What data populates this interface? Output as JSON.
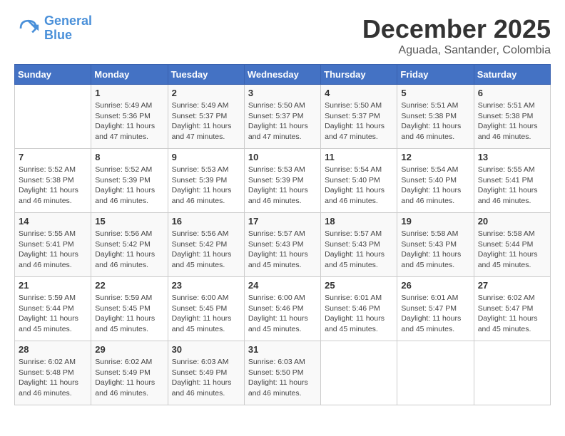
{
  "header": {
    "logo_line1": "General",
    "logo_line2": "Blue",
    "month": "December 2025",
    "location": "Aguada, Santander, Colombia"
  },
  "weekdays": [
    "Sunday",
    "Monday",
    "Tuesday",
    "Wednesday",
    "Thursday",
    "Friday",
    "Saturday"
  ],
  "weeks": [
    [
      {
        "day": "",
        "info": ""
      },
      {
        "day": "1",
        "info": "Sunrise: 5:49 AM\nSunset: 5:36 PM\nDaylight: 11 hours\nand 47 minutes."
      },
      {
        "day": "2",
        "info": "Sunrise: 5:49 AM\nSunset: 5:37 PM\nDaylight: 11 hours\nand 47 minutes."
      },
      {
        "day": "3",
        "info": "Sunrise: 5:50 AM\nSunset: 5:37 PM\nDaylight: 11 hours\nand 47 minutes."
      },
      {
        "day": "4",
        "info": "Sunrise: 5:50 AM\nSunset: 5:37 PM\nDaylight: 11 hours\nand 47 minutes."
      },
      {
        "day": "5",
        "info": "Sunrise: 5:51 AM\nSunset: 5:38 PM\nDaylight: 11 hours\nand 46 minutes."
      },
      {
        "day": "6",
        "info": "Sunrise: 5:51 AM\nSunset: 5:38 PM\nDaylight: 11 hours\nand 46 minutes."
      }
    ],
    [
      {
        "day": "7",
        "info": "Sunrise: 5:52 AM\nSunset: 5:38 PM\nDaylight: 11 hours\nand 46 minutes."
      },
      {
        "day": "8",
        "info": "Sunrise: 5:52 AM\nSunset: 5:39 PM\nDaylight: 11 hours\nand 46 minutes."
      },
      {
        "day": "9",
        "info": "Sunrise: 5:53 AM\nSunset: 5:39 PM\nDaylight: 11 hours\nand 46 minutes."
      },
      {
        "day": "10",
        "info": "Sunrise: 5:53 AM\nSunset: 5:39 PM\nDaylight: 11 hours\nand 46 minutes."
      },
      {
        "day": "11",
        "info": "Sunrise: 5:54 AM\nSunset: 5:40 PM\nDaylight: 11 hours\nand 46 minutes."
      },
      {
        "day": "12",
        "info": "Sunrise: 5:54 AM\nSunset: 5:40 PM\nDaylight: 11 hours\nand 46 minutes."
      },
      {
        "day": "13",
        "info": "Sunrise: 5:55 AM\nSunset: 5:41 PM\nDaylight: 11 hours\nand 46 minutes."
      }
    ],
    [
      {
        "day": "14",
        "info": "Sunrise: 5:55 AM\nSunset: 5:41 PM\nDaylight: 11 hours\nand 46 minutes."
      },
      {
        "day": "15",
        "info": "Sunrise: 5:56 AM\nSunset: 5:42 PM\nDaylight: 11 hours\nand 46 minutes."
      },
      {
        "day": "16",
        "info": "Sunrise: 5:56 AM\nSunset: 5:42 PM\nDaylight: 11 hours\nand 45 minutes."
      },
      {
        "day": "17",
        "info": "Sunrise: 5:57 AM\nSunset: 5:43 PM\nDaylight: 11 hours\nand 45 minutes."
      },
      {
        "day": "18",
        "info": "Sunrise: 5:57 AM\nSunset: 5:43 PM\nDaylight: 11 hours\nand 45 minutes."
      },
      {
        "day": "19",
        "info": "Sunrise: 5:58 AM\nSunset: 5:43 PM\nDaylight: 11 hours\nand 45 minutes."
      },
      {
        "day": "20",
        "info": "Sunrise: 5:58 AM\nSunset: 5:44 PM\nDaylight: 11 hours\nand 45 minutes."
      }
    ],
    [
      {
        "day": "21",
        "info": "Sunrise: 5:59 AM\nSunset: 5:44 PM\nDaylight: 11 hours\nand 45 minutes."
      },
      {
        "day": "22",
        "info": "Sunrise: 5:59 AM\nSunset: 5:45 PM\nDaylight: 11 hours\nand 45 minutes."
      },
      {
        "day": "23",
        "info": "Sunrise: 6:00 AM\nSunset: 5:45 PM\nDaylight: 11 hours\nand 45 minutes."
      },
      {
        "day": "24",
        "info": "Sunrise: 6:00 AM\nSunset: 5:46 PM\nDaylight: 11 hours\nand 45 minutes."
      },
      {
        "day": "25",
        "info": "Sunrise: 6:01 AM\nSunset: 5:46 PM\nDaylight: 11 hours\nand 45 minutes."
      },
      {
        "day": "26",
        "info": "Sunrise: 6:01 AM\nSunset: 5:47 PM\nDaylight: 11 hours\nand 45 minutes."
      },
      {
        "day": "27",
        "info": "Sunrise: 6:02 AM\nSunset: 5:47 PM\nDaylight: 11 hours\nand 45 minutes."
      }
    ],
    [
      {
        "day": "28",
        "info": "Sunrise: 6:02 AM\nSunset: 5:48 PM\nDaylight: 11 hours\nand 46 minutes."
      },
      {
        "day": "29",
        "info": "Sunrise: 6:02 AM\nSunset: 5:49 PM\nDaylight: 11 hours\nand 46 minutes."
      },
      {
        "day": "30",
        "info": "Sunrise: 6:03 AM\nSunset: 5:49 PM\nDaylight: 11 hours\nand 46 minutes."
      },
      {
        "day": "31",
        "info": "Sunrise: 6:03 AM\nSunset: 5:50 PM\nDaylight: 11 hours\nand 46 minutes."
      },
      {
        "day": "",
        "info": ""
      },
      {
        "day": "",
        "info": ""
      },
      {
        "day": "",
        "info": ""
      }
    ]
  ]
}
